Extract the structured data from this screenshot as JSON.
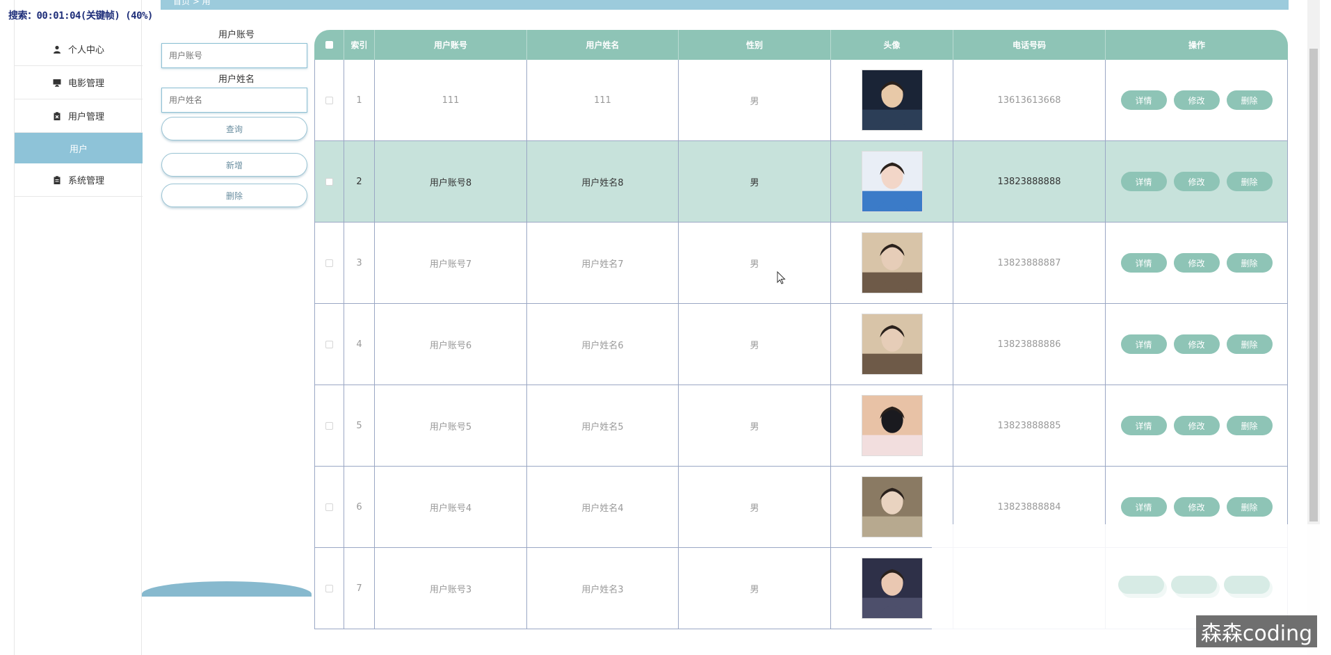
{
  "recording": {
    "text": "搜索：00:01:04(关键帧) (40%)"
  },
  "breadcrumb": {
    "text": "首页 > 用"
  },
  "sidebar": {
    "items": [
      {
        "label": "个人中心",
        "icon": "person-icon"
      },
      {
        "label": "电影管理",
        "icon": "monitor-icon"
      },
      {
        "label": "用户管理",
        "icon": "clipboard-x-icon"
      },
      {
        "label": "用户",
        "sub": true
      },
      {
        "label": "系统管理",
        "icon": "clipboard-icon"
      }
    ]
  },
  "search": {
    "account_label": "用户账号",
    "account_placeholder": "用户账号",
    "name_label": "用户姓名",
    "name_placeholder": "用户姓名",
    "query_btn": "查询",
    "add_btn": "新增",
    "delete_btn": "删除"
  },
  "table": {
    "headers": [
      "索引",
      "用户账号",
      "用户姓名",
      "性别",
      "头像",
      "电话号码",
      "操作"
    ],
    "rows": [
      {
        "index": "1",
        "account": "111",
        "name": "111",
        "gender": "男",
        "phone": "13613613668"
      },
      {
        "index": "2",
        "account": "用户账号8",
        "name": "用户姓名8",
        "gender": "男",
        "phone": "13823888888"
      },
      {
        "index": "3",
        "account": "用户账号7",
        "name": "用户姓名7",
        "gender": "男",
        "phone": "13823888887"
      },
      {
        "index": "4",
        "account": "用户账号6",
        "name": "用户姓名6",
        "gender": "男",
        "phone": "13823888886"
      },
      {
        "index": "5",
        "account": "用户账号5",
        "name": "用户姓名5",
        "gender": "男",
        "phone": "13823888885"
      },
      {
        "index": "6",
        "account": "用户账号4",
        "name": "用户姓名4",
        "gender": "男",
        "phone": "13823888884"
      },
      {
        "index": "7",
        "account": "用户账号3",
        "name": "用户姓名3",
        "gender": "男",
        "phone": ""
      }
    ],
    "actions": {
      "detail": "详情",
      "edit": "修改",
      "delete": "删除"
    }
  },
  "watermark": {
    "text": "森森coding"
  },
  "colors": {
    "accent": "#8ec4b6",
    "sidebar_active": "#8ec3d8",
    "active_row": "#c7e2db"
  }
}
